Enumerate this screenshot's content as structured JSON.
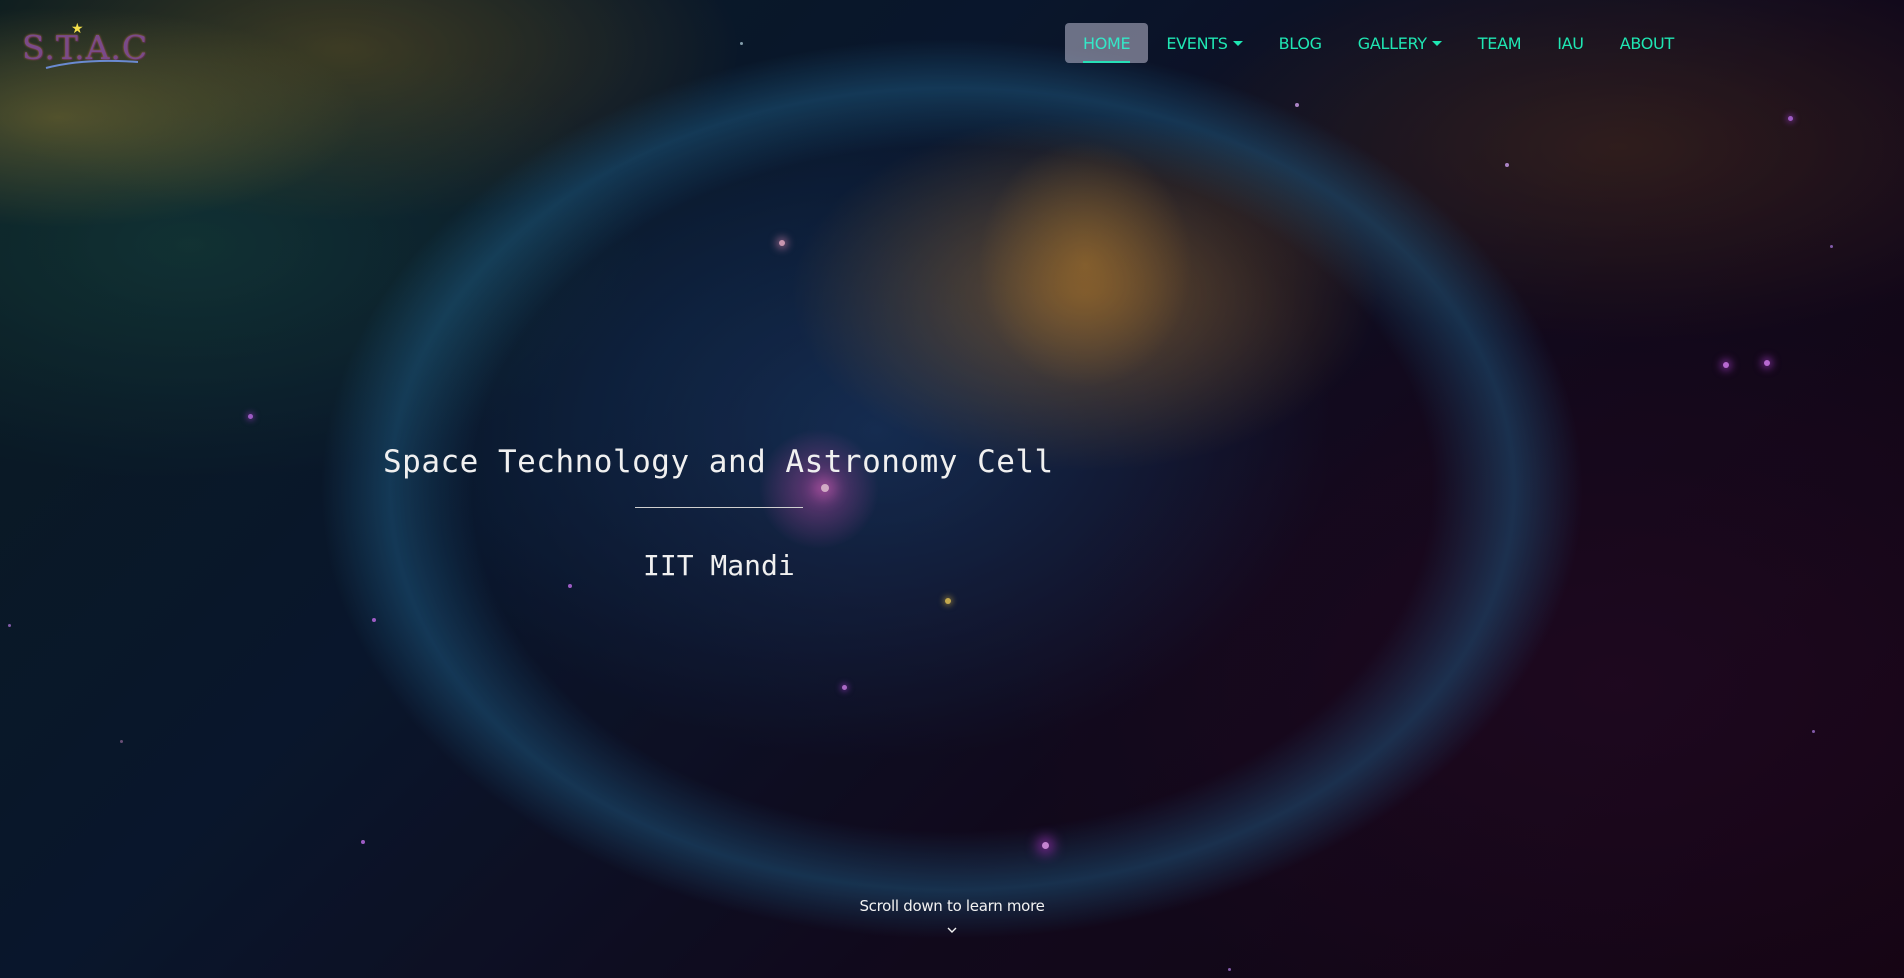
{
  "brand": {
    "logo_text": "S.T.A.C"
  },
  "nav": {
    "items": [
      {
        "label": "HOME",
        "active": true,
        "dropdown": false
      },
      {
        "label": "EVENTS",
        "active": false,
        "dropdown": true
      },
      {
        "label": "BLOG",
        "active": false,
        "dropdown": false
      },
      {
        "label": "GALLERY",
        "active": false,
        "dropdown": true
      },
      {
        "label": "TEAM",
        "active": false,
        "dropdown": false
      },
      {
        "label": "IAU",
        "active": false,
        "dropdown": false
      },
      {
        "label": "ABOUT",
        "active": false,
        "dropdown": false
      }
    ]
  },
  "hero": {
    "title": "Space Technology and Astronomy Cell",
    "subtitle": "IIT Mandi"
  },
  "scroll": {
    "label": "Scroll down to learn more",
    "icon": "chevron-down-icon"
  },
  "colors": {
    "nav_text": "#1fe6b3",
    "hero_text": "#f0f0f0"
  }
}
